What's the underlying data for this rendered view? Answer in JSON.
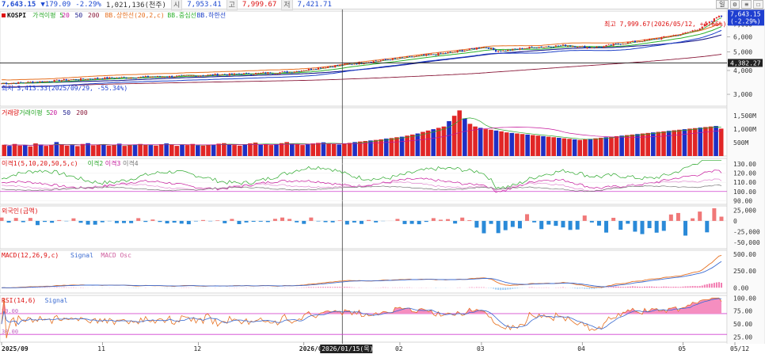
{
  "header": {
    "price": "7,643.15",
    "change": "▼179.09",
    "change_pct": "-2.29%",
    "volume": "1,021,136(천주)",
    "open_label": "시",
    "open": "7,953.41",
    "high_label": "고",
    "high": "7,999.67",
    "low_label": "저",
    "low": "7,421.71",
    "btn_day": "일",
    "btn_settings": "⚙",
    "btn_menu": "≡",
    "btn_close": "☐"
  },
  "colors": {
    "up": "#e12626",
    "down": "#1f2fc4",
    "ma5": "#2ba82b",
    "ma20": "#c6189c",
    "ma50": "#1a1a8c",
    "ma200": "#8a1a3a",
    "bb_upper": "#e67020",
    "bb_mid": "#2bb02b",
    "bb_lower": "#1c3fc8",
    "macd": "#e67020",
    "signal": "#3a6ad1",
    "osc_pos": "#f27ab0",
    "osc_neg": "#9ccaf2",
    "rsi": "#e67020",
    "rsi_fill": "#f58ec0",
    "foreign_pos": "#f07878",
    "foreign_neg": "#2a8ad8",
    "ref_line": "#d040d0"
  },
  "chart_data": [
    {
      "type": "candlestick",
      "title": "KOSPI",
      "legend": [
        {
          "label": "KOSPI",
          "color": "#d11"
        },
        {
          "label": "가격이평 5",
          "color": "#2ba82b"
        },
        {
          "label": "20",
          "color": "#c6189c"
        },
        {
          "label": "50",
          "color": "#1a1a8c"
        },
        {
          "label": "200",
          "color": "#8a1a3a"
        },
        {
          "label": "BB.상한선(20,2,c)",
          "color": "#e67020"
        },
        {
          "label": "BB.중심선",
          "color": "#2bb02b"
        },
        {
          "label": "BB.하한선",
          "color": "#1c3fc8"
        }
      ],
      "y_ticks": [
        "3,000",
        "4,000",
        "5,000",
        "6,000",
        "7,000"
      ],
      "y_tick_values": [
        3000,
        4000,
        5000,
        6000,
        7000
      ],
      "ylim": [
        2600,
        8200
      ],
      "log_scale": true,
      "current_price_label": "7,643.15",
      "current_change_label": "(-2.29%)",
      "high_annotation": "최고 7,999.67(2026/05/12, +4.66%)",
      "low_annotation": "최저 3,413.33(2025/09/29, -55.34%)",
      "ref_value_label": "4,382.27",
      "ref_value": 4382.27,
      "x_labels": [
        "2025/09",
        "11",
        "12",
        "2026/0",
        "02",
        "03",
        "04",
        "05",
        "05/12"
      ],
      "x_label_index": [
        0,
        42,
        82,
        126,
        166,
        200,
        242,
        284,
        301
      ],
      "crosshair_label": "2026/01/15(목)",
      "crosshair_index": 142,
      "n_candles": 301,
      "close_path": [
        [
          0,
          3420
        ],
        [
          10,
          3460
        ],
        [
          20,
          3520
        ],
        [
          30,
          3590
        ],
        [
          40,
          3630
        ],
        [
          50,
          3670
        ],
        [
          60,
          3700
        ],
        [
          70,
          3720
        ],
        [
          80,
          3760
        ],
        [
          90,
          3800
        ],
        [
          100,
          3840
        ],
        [
          110,
          3880
        ],
        [
          120,
          3930
        ],
        [
          128,
          4050
        ],
        [
          135,
          4180
        ],
        [
          145,
          4320
        ],
        [
          155,
          4470
        ],
        [
          165,
          4620
        ],
        [
          175,
          4780
        ],
        [
          185,
          4930
        ],
        [
          195,
          5150
        ],
        [
          200,
          5320
        ],
        [
          203,
          5260
        ],
        [
          206,
          5070
        ],
        [
          210,
          5080
        ],
        [
          215,
          5180
        ],
        [
          220,
          5280
        ],
        [
          228,
          5350
        ],
        [
          235,
          5420
        ],
        [
          240,
          5350
        ],
        [
          245,
          5280
        ],
        [
          250,
          5320
        ],
        [
          255,
          5470
        ],
        [
          262,
          5620
        ],
        [
          270,
          5800
        ],
        [
          277,
          6000
        ],
        [
          284,
          6250
        ],
        [
          290,
          6600
        ],
        [
          296,
          7250
        ],
        [
          299,
          7820
        ],
        [
          301,
          7643
        ]
      ],
      "volume": {
        "legend": [
          "거래량",
          "거래이평 5",
          "20",
          "50",
          "200"
        ],
        "y_ticks": [
          "1,500M",
          "1,000M",
          "500M"
        ],
        "y_tick_values": [
          1500,
          1000,
          500
        ],
        "ylim": [
          0,
          1800
        ],
        "bars": [
          420,
          380,
          450,
          390,
          410,
          360,
          470,
          430,
          380,
          400,
          520,
          440,
          390,
          410,
          370,
          450,
          480,
          400,
          420,
          430,
          390,
          410,
          460,
          380,
          400,
          430,
          450,
          420,
          410,
          390,
          440,
          470,
          430,
          380,
          420,
          410,
          450,
          400,
          390,
          420,
          430,
          460,
          480,
          420,
          410,
          390,
          440,
          470,
          500,
          420,
          430,
          410,
          450,
          480,
          520,
          460,
          430,
          410,
          440,
          470,
          490,
          510,
          470,
          450,
          430,
          460,
          490,
          520,
          540,
          560,
          580,
          600,
          620,
          650,
          670,
          700,
          720,
          760,
          800,
          840,
          900,
          950,
          1000,
          1050,
          1100,
          1300,
          1500,
          1700,
          1400,
          1200,
          1100,
          1050,
          1000,
          980,
          950,
          920,
          880,
          860,
          840,
          820,
          800,
          780,
          760,
          740,
          720,
          700,
          680,
          660,
          640,
          620,
          600,
          620,
          640,
          660,
          680,
          700,
          720,
          740,
          760,
          780,
          800,
          820,
          840,
          860,
          880,
          900,
          920,
          940,
          960,
          980,
          1000,
          1020,
          1040,
          1060,
          1080,
          1100,
          1120,
          1021
        ]
      }
    },
    {
      "type": "line",
      "title": "이격1(5,10,20,50,5,c)",
      "legend": [
        "이격1(5,10,20,50,5,c)",
        "이격2",
        "이격3",
        "이격4"
      ],
      "y_ticks": [
        "130.00",
        "120.00",
        "110.00",
        "100.00",
        "90.00"
      ],
      "y_tick_values": [
        130,
        120,
        110,
        100,
        90
      ],
      "ylim": [
        86,
        136
      ]
    },
    {
      "type": "bar",
      "title": "외국인(금액)",
      "y_ticks": [
        "25,000",
        "0",
        "-25,000",
        "-50,000"
      ],
      "y_tick_values": [
        25000,
        0,
        -25000,
        -50000
      ],
      "ylim": [
        -65000,
        35000
      ]
    },
    {
      "type": "line",
      "title": "MACD(12,26,9,c)",
      "legend": [
        "MACD(12,26,9,c)",
        "Signal",
        "MACD Osc"
      ],
      "y_ticks": [
        "500.00",
        "250.00",
        "0.00"
      ],
      "y_tick_values": [
        500,
        250,
        0
      ],
      "ylim": [
        -80,
        560
      ]
    },
    {
      "type": "area",
      "title": "RSI(14,6)",
      "legend": [
        "RSI(14,6)",
        "Signal"
      ],
      "y_ticks": [
        "100.00",
        "75.00",
        "50.00",
        "25.00"
      ],
      "y_tick_values": [
        100,
        75,
        50,
        25
      ],
      "ylim": [
        15,
        105
      ],
      "ref_lines": [
        70,
        30
      ],
      "ref_line_labels": [
        "70.00",
        "30.00"
      ]
    }
  ]
}
